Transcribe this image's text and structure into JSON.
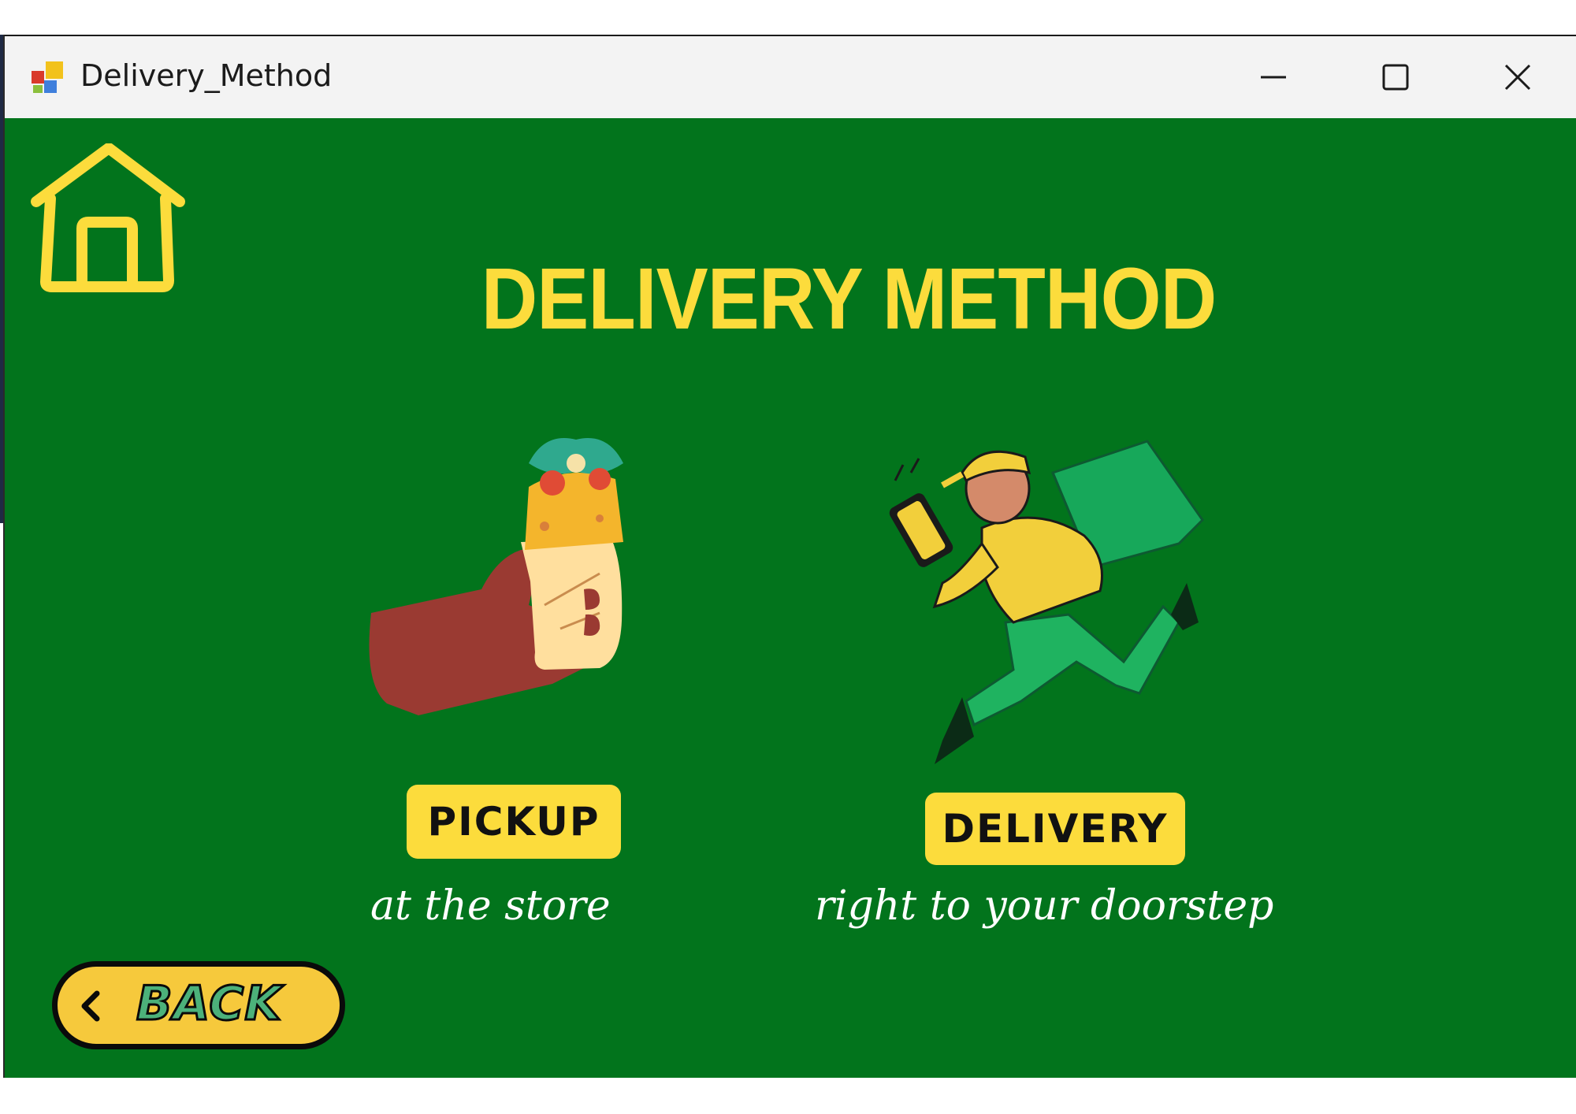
{
  "window": {
    "title": "Delivery_Method",
    "controls": {
      "minimize": "minimize",
      "maximize": "maximize",
      "close": "close"
    }
  },
  "page": {
    "heading": "DELIVERY METHOD",
    "home_icon": "home-icon"
  },
  "options": [
    {
      "label": "PICKUP",
      "subtitle": "at the store",
      "illustration": "hand-holding-wrap"
    },
    {
      "label": "DELIVERY",
      "subtitle": "right to your doorstep",
      "illustration": "courier-running-with-phone"
    }
  ],
  "back_button": {
    "label": "BACK",
    "icon": "chevron-left-icon"
  },
  "colors": {
    "background": "#02741c",
    "accent": "#fcdc3c",
    "button": "#f6c93c",
    "text_light": "#ffffff"
  }
}
